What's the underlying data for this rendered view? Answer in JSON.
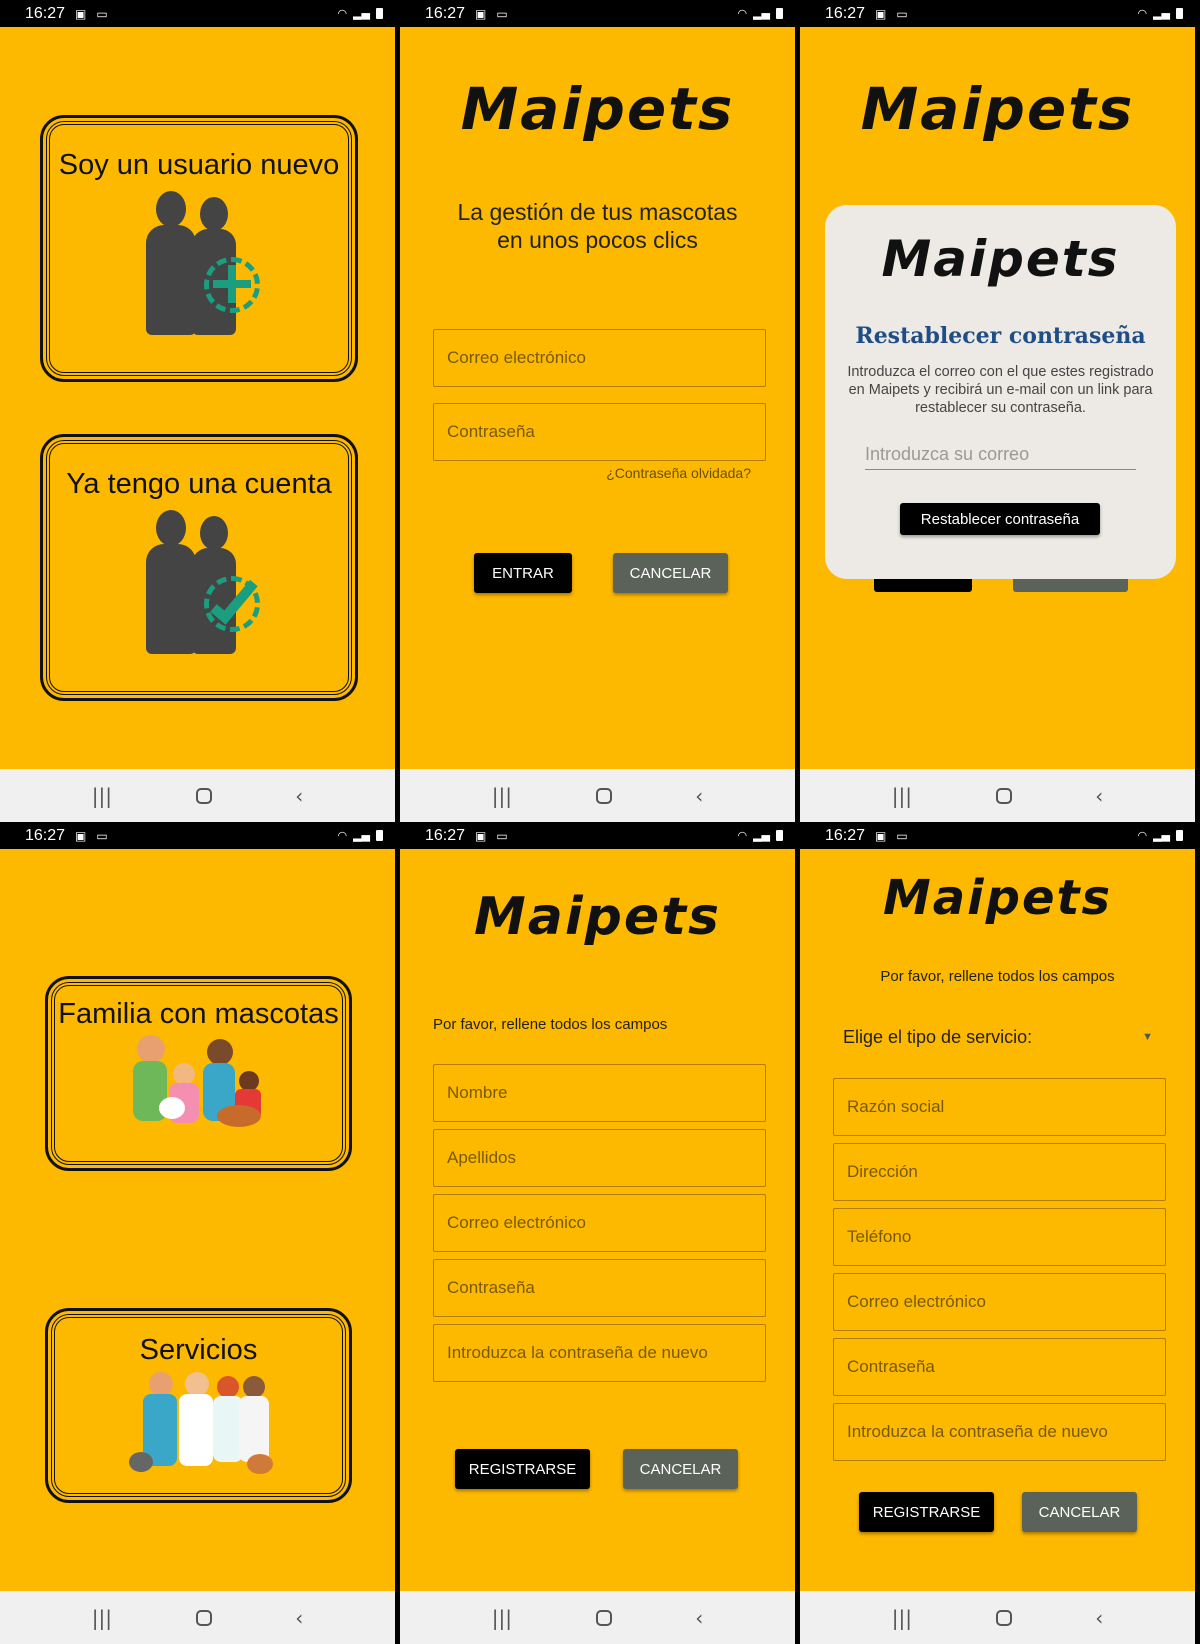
{
  "status": {
    "time": "16:27"
  },
  "brand": {
    "logo": "Maipets"
  },
  "screen1": {
    "new_user_title": "Soy un usuario nuevo",
    "existing_user_title": "Ya tengo una cuenta"
  },
  "screen2": {
    "tagline_line1": "La gestión de tus mascotas",
    "tagline_line2": "en unos pocos clics",
    "email_placeholder": "Correo electrónico",
    "password_placeholder": "Contraseña",
    "forgot_link": "¿Contraseña olvidada?",
    "enter_button": "ENTRAR",
    "cancel_button": "CANCELAR"
  },
  "screen3": {
    "dialog_title": "Restablecer contraseña",
    "dialog_text": "Introduzca el correo con el que estes registrado en Maipets y recibirá un e-mail con un link para restablecer su contraseña.",
    "email_placeholder": "Introduzca su correo",
    "reset_button": "Restablecer contraseña"
  },
  "screen4": {
    "family_title": "Familia con mascotas",
    "services_title": "Servicios"
  },
  "screen5": {
    "instruction": "Por favor, rellene todos los campos",
    "fields": [
      "Nombre",
      "Apellidos",
      "Correo electrónico",
      "Contraseña",
      "Introduzca la contraseña de nuevo"
    ],
    "register_button": "REGISTRARSE",
    "cancel_button": "CANCELAR"
  },
  "screen6": {
    "instruction": "Por favor, rellene todos los campos",
    "service_type_label": "Elige el tipo de servicio:",
    "fields": [
      "Razón social",
      "Dirección",
      "Teléfono",
      "Correo electrónico",
      "Contraseña",
      "Introduzca la contraseña de nuevo"
    ],
    "register_button": "REGISTRARSE",
    "cancel_button": "CANCELAR"
  },
  "colors": {
    "background": "#FDB900",
    "accent_green": "#1A9E7F",
    "dialog_title": "#1F4E86"
  }
}
